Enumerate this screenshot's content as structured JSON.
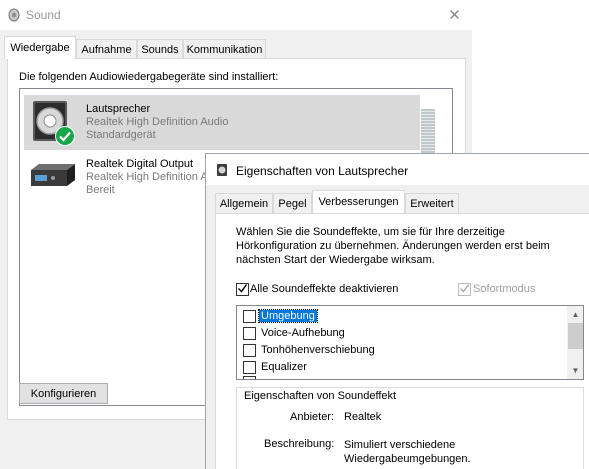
{
  "sound_window": {
    "title": "Sound",
    "close_symbol": "✕",
    "tabs": [
      {
        "label": "Wiedergabe",
        "active": true
      },
      {
        "label": "Aufnahme",
        "active": false
      },
      {
        "label": "Sounds",
        "active": false
      },
      {
        "label": "Kommunikation",
        "active": false
      }
    ],
    "intro": "Die folgenden Audiowiedergabegeräte sind installiert:",
    "devices": [
      {
        "name": "Lautsprecher",
        "driver": "Realtek High Definition Audio",
        "status": "Standardgerät",
        "icon": "speaker-icon",
        "default_badge": "green-check-badge-icon",
        "selected": true
      },
      {
        "name": "Realtek Digital Output",
        "driver": "Realtek High Definition Audio",
        "status": "Bereit",
        "icon": "digital-output-device-icon",
        "selected": false
      }
    ],
    "configure_button": "Konfigurieren"
  },
  "properties_dialog": {
    "title": "Eigenschaften von Lautsprecher",
    "tabs": [
      {
        "label": "Allgemein",
        "active": false
      },
      {
        "label": "Pegel",
        "active": false
      },
      {
        "label": "Verbesserungen",
        "active": true
      },
      {
        "label": "Erweitert",
        "active": false
      }
    ],
    "description": "Wählen Sie die Soundeffekte, um sie für Ihre derzeitige Hörkonfiguration zu übernehmen. Änderungen werden erst beim nächsten Start der Wiedergabe wirksam.",
    "disable_all": {
      "label": "Alle Soundeffekte deaktivieren",
      "checked": true
    },
    "immediate_mode": {
      "label": "Sofortmodus",
      "checked": true,
      "enabled": false
    },
    "effects": [
      {
        "label": "Umgebung",
        "checked": false,
        "selected": true
      },
      {
        "label": "Voice-Aufhebung",
        "checked": false,
        "selected": false
      },
      {
        "label": "Tonhöhenverschiebung",
        "checked": false,
        "selected": false
      },
      {
        "label": "Equalizer",
        "checked": false,
        "selected": false
      }
    ],
    "effect_properties": {
      "group_title": "Eigenschaften von Soundeffekt",
      "provider_label": "Anbieter:",
      "provider_value": "Realtek",
      "description_label": "Beschreibung:",
      "description_value": "Simuliert verschiedene Wiedergabeumgebungen."
    }
  },
  "colors": {
    "selection_blue": "#0078d7",
    "selected_row_gray": "#d9d9d9",
    "badge_green": "#17a74a"
  }
}
